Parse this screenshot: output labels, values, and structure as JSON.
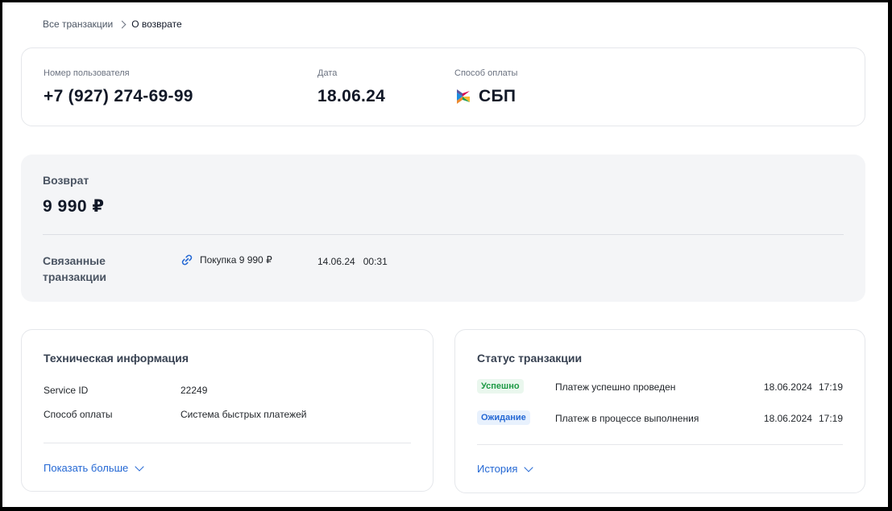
{
  "breadcrumb": {
    "parent": "Все транзакции",
    "current": "О возврате"
  },
  "info": {
    "phone_label": "Номер пользователя",
    "phone_value": "+7 (927) 274-69-99",
    "date_label": "Дата",
    "date_value": "18.06.24",
    "method_label": "Способ оплаты",
    "method_value": "СБП",
    "method_icon": "sbp-logo-icon"
  },
  "refund": {
    "title": "Возврат",
    "amount": "9 990 ₽",
    "related_label": "Связанные транзакции",
    "related_link": "Покупка 9 990 ₽",
    "related_date": "14.06.24",
    "related_time": "00:31"
  },
  "tech": {
    "title": "Техническая информация",
    "rows": [
      {
        "key": "Service ID",
        "value": "22249"
      },
      {
        "key": "Способ оплаты",
        "value": "Система быстрых платежей"
      }
    ],
    "more": "Показать больше"
  },
  "status": {
    "title": "Статус транзакции",
    "rows": [
      {
        "badge": "Успешно",
        "text": "Платеж успешно проведен",
        "date": "18.06.2024",
        "time": "17:19"
      },
      {
        "badge": "Ожидание",
        "text": "Платеж в процессе выполнения",
        "date": "18.06.2024",
        "time": "17:19"
      }
    ],
    "history": "История"
  },
  "colors": {
    "accent": "#2468d4",
    "success": "#1e9a45",
    "panel": "#f4f5f7"
  }
}
